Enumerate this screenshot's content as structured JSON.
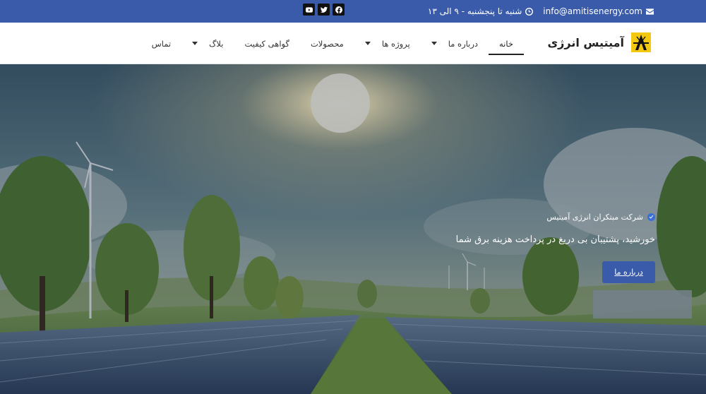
{
  "topbar": {
    "email": "info@amitisenergy.com",
    "hours": "شنبه تا پنجشنبه - ۹ الی ۱۳",
    "social": [
      "facebook-icon",
      "twitter-icon",
      "youtube-icon"
    ]
  },
  "brand": {
    "name": "آمیتیس انرژی"
  },
  "nav": {
    "items": [
      {
        "label": "خانه",
        "active": true,
        "dropdown": false
      },
      {
        "label": "درباره ما",
        "active": false,
        "dropdown": true
      },
      {
        "label": "پروژه ها",
        "active": false,
        "dropdown": true
      },
      {
        "label": "محصولات",
        "active": false,
        "dropdown": false
      },
      {
        "label": "گواهی کیفیت",
        "active": false,
        "dropdown": false
      },
      {
        "label": "بلاگ",
        "active": false,
        "dropdown": true
      },
      {
        "label": "تماس",
        "active": false,
        "dropdown": false
      }
    ]
  },
  "hero": {
    "kicker": "شرکت مبتکران انرژی آمیتیس",
    "tagline": "خورشید، پشتیبان بی دریغ در پرداخت هزینه برق شما",
    "cta": "درباره ما"
  },
  "colors": {
    "primary": "#3a5ba9",
    "topbar_bg": "#3a5ba9",
    "header_bg": "#ffffff"
  }
}
